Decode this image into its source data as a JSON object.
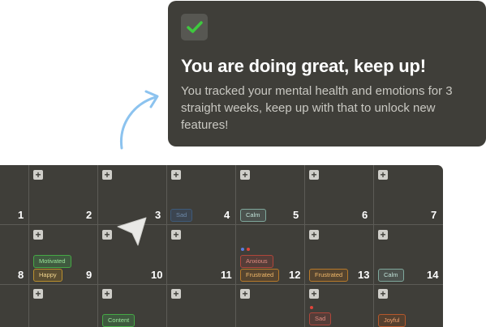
{
  "colors": {
    "check_green": "#3ec93e",
    "card_bg": "#3f3e39",
    "arrow": "#8cc3ef"
  },
  "card": {
    "title": "You are doing great, keep up!",
    "body": "You tracked your mental health and emotions for 3 straight weeks, keep up with that to unlock new features!",
    "check_icon": "check-icon"
  },
  "calendar": {
    "add_icon": "+",
    "days": [
      "1",
      "2",
      "3",
      "4",
      "5",
      "6",
      "7",
      "8",
      "9",
      "10",
      "11",
      "12",
      "13",
      "14"
    ],
    "tags": {
      "d4": "Sad",
      "d5": "Calm",
      "d9_a": "Motivated",
      "d9_b": "Happy",
      "d12_a": "Anxious",
      "d12_b": "Frustrated",
      "d13": "Frustrated",
      "d14": "Calm",
      "r3_c2": "Content",
      "r3_c5": "Sad",
      "r3_c6": "Joyful"
    }
  }
}
